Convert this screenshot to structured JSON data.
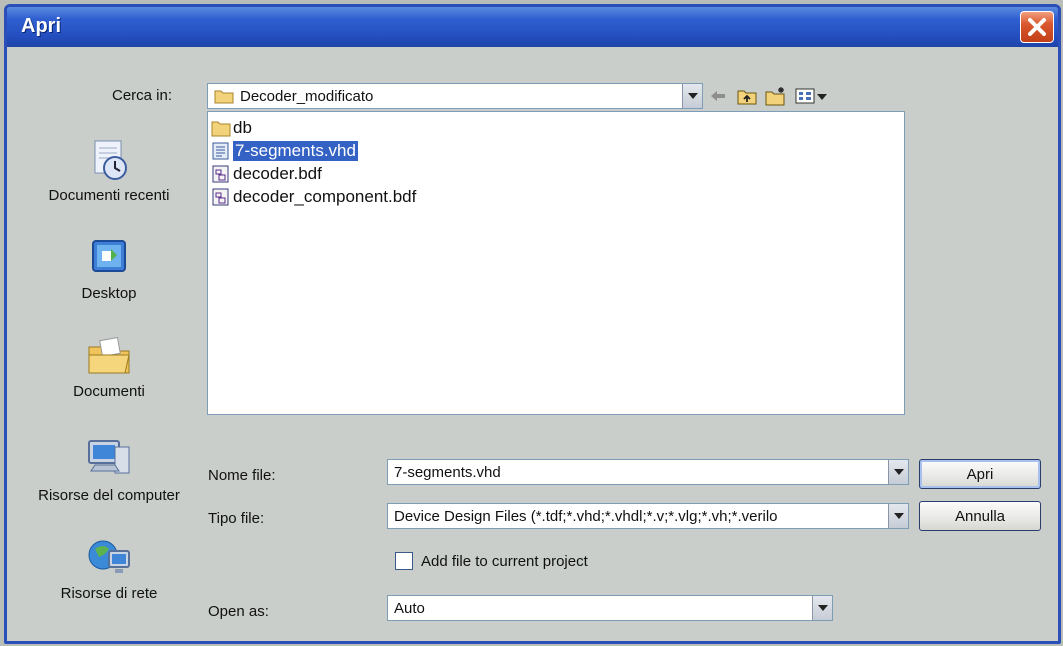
{
  "window": {
    "title": "Apri"
  },
  "look_in": {
    "label": "Cerca in:",
    "value": "Decoder_modificato"
  },
  "places": [
    {
      "label": "Documenti recenti",
      "icon": "recent-documents-icon"
    },
    {
      "label": "Desktop",
      "icon": "desktop-icon"
    },
    {
      "label": "Documenti",
      "icon": "documents-folder-icon"
    },
    {
      "label": "Risorse del computer",
      "icon": "my-computer-icon"
    },
    {
      "label": "Risorse di rete",
      "icon": "network-icon"
    }
  ],
  "files": [
    {
      "name": "db",
      "icon": "folder-icon",
      "selected": false
    },
    {
      "name": "7-segments.vhd",
      "icon": "vhd-file-icon",
      "selected": true
    },
    {
      "name": "decoder.bdf",
      "icon": "bdf-file-icon",
      "selected": false
    },
    {
      "name": "decoder_component.bdf",
      "icon": "bdf-file-icon",
      "selected": false
    }
  ],
  "file_name": {
    "label": "Nome file:",
    "value": "7-segments.vhd"
  },
  "file_type": {
    "label": "Tipo file:",
    "value": "Device Design Files (*.tdf;*.vhd;*.vhdl;*.v;*.vlg;*.vh;*.verilo"
  },
  "add_to_project": {
    "label": "Add file to current project",
    "checked": false
  },
  "open_as": {
    "label": "Open as:",
    "value": "Auto"
  },
  "buttons": {
    "open": "Apri",
    "cancel": "Annulla"
  },
  "colors": {
    "titlebar": "#2550c2",
    "selection": "#3461c4",
    "close": "#d9582e"
  }
}
